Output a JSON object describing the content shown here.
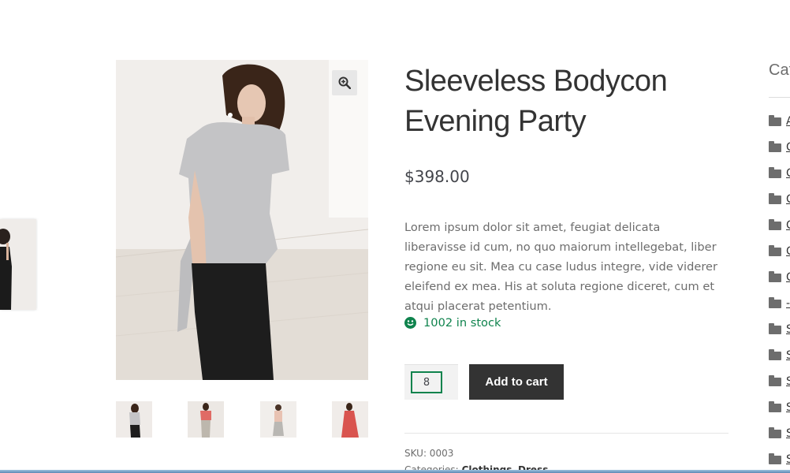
{
  "product": {
    "title": "Sleeveless Bodycon Evening Party",
    "price": "$398.00",
    "description": "Lorem ipsum dolor sit amet, feugiat delicata liberavisse id cum, no quo maiorum intellegebat, liber regione eu sit. Mea cu case ludus integre, vide viderer eleifend ex mea. His at soluta regione diceret, cum et atqui placerat petentium.",
    "stock": "1002 in stock",
    "quantity": "8",
    "add_to_cart_label": "Add to cart",
    "sku": "SKU: 0003",
    "categories_label": "Categories:",
    "categories": [
      "Clothings",
      "Dress"
    ]
  },
  "gallery": {
    "zoom_icon": "zoom-in-icon",
    "thumbnail_count": 4
  },
  "sidebar": {
    "title": "Cat",
    "items": [
      {
        "label": "A"
      },
      {
        "label": "C"
      },
      {
        "label": "C"
      },
      {
        "label": "C"
      },
      {
        "label": "C"
      },
      {
        "label": "C"
      },
      {
        "label": "C"
      },
      {
        "label": "-"
      },
      {
        "label": "S"
      },
      {
        "label": "S"
      },
      {
        "label": "S"
      },
      {
        "label": "S"
      },
      {
        "label": "S"
      },
      {
        "label": "S"
      }
    ]
  },
  "colors": {
    "accent": "#0f834d",
    "button": "#333333",
    "text": "#43454b"
  }
}
